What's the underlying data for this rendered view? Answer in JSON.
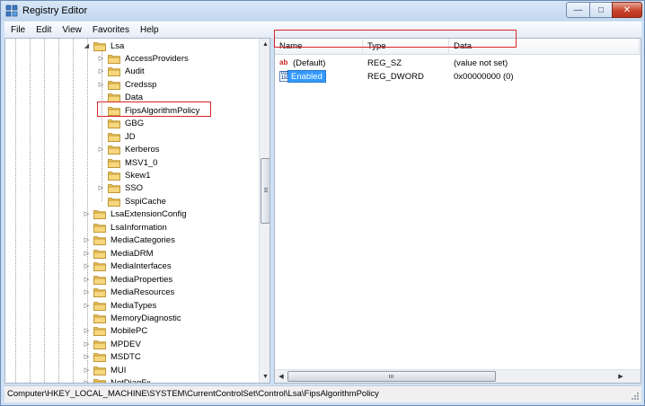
{
  "window": {
    "title": "Registry Editor",
    "controls": {
      "minimize": "—",
      "maximize": "□",
      "close": "✕"
    }
  },
  "menu": [
    "File",
    "Edit",
    "View",
    "Favorites",
    "Help"
  ],
  "tree": {
    "items": [
      {
        "label": "Lsa",
        "level": 0,
        "expander": "◢"
      },
      {
        "label": "AccessProviders",
        "level": 1,
        "expander": "▷"
      },
      {
        "label": "Audit",
        "level": 1,
        "expander": "▷"
      },
      {
        "label": "Credssp",
        "level": 1,
        "expander": "▷"
      },
      {
        "label": "Data",
        "level": 1,
        "expander": ""
      },
      {
        "label": "FipsAlgorithmPolicy",
        "level": 1,
        "expander": "",
        "selected": true
      },
      {
        "label": "GBG",
        "level": 1,
        "expander": ""
      },
      {
        "label": "JD",
        "level": 1,
        "expander": ""
      },
      {
        "label": "Kerberos",
        "level": 1,
        "expander": "▷"
      },
      {
        "label": "MSV1_0",
        "level": 1,
        "expander": ""
      },
      {
        "label": "Skew1",
        "level": 1,
        "expander": ""
      },
      {
        "label": "SSO",
        "level": 1,
        "expander": "▷"
      },
      {
        "label": "SspiCache",
        "level": 1,
        "expander": ""
      },
      {
        "label": "LsaExtensionConfig",
        "level": 0,
        "expander": "▷"
      },
      {
        "label": "LsaInformation",
        "level": 0,
        "expander": ""
      },
      {
        "label": "MediaCategories",
        "level": 0,
        "expander": "▷"
      },
      {
        "label": "MediaDRM",
        "level": 0,
        "expander": "▷"
      },
      {
        "label": "MediaInterfaces",
        "level": 0,
        "expander": "▷"
      },
      {
        "label": "MediaProperties",
        "level": 0,
        "expander": "▷"
      },
      {
        "label": "MediaResources",
        "level": 0,
        "expander": "▷"
      },
      {
        "label": "MediaTypes",
        "level": 0,
        "expander": "▷"
      },
      {
        "label": "MemoryDiagnostic",
        "level": 0,
        "expander": ""
      },
      {
        "label": "MobilePC",
        "level": 0,
        "expander": "▷"
      },
      {
        "label": "MPDEV",
        "level": 0,
        "expander": "▷"
      },
      {
        "label": "MSDTC",
        "level": 0,
        "expander": "▷"
      },
      {
        "label": "MUI",
        "level": 0,
        "expander": "▷"
      },
      {
        "label": "NetDiagFx",
        "level": 0,
        "expander": "▷"
      }
    ]
  },
  "list": {
    "columns": [
      "Name",
      "Type",
      "Data"
    ],
    "rows": [
      {
        "icon": "string-value-icon",
        "name": "(Default)",
        "type": "REG_SZ",
        "data": "(value not set)"
      },
      {
        "icon": "dword-value-icon",
        "name": "Enabled",
        "type": "REG_DWORD",
        "data": "0x00000000 (0)",
        "selected": true
      }
    ]
  },
  "status": {
    "path": "Computer\\HKEY_LOCAL_MACHINE\\SYSTEM\\CurrentControlSet\\Control\\Lsa\\FipsAlgorithmPolicy"
  },
  "colors": {
    "selection": "#3399ff",
    "annotation": "#d9252a",
    "folder": "#e8c15a"
  }
}
